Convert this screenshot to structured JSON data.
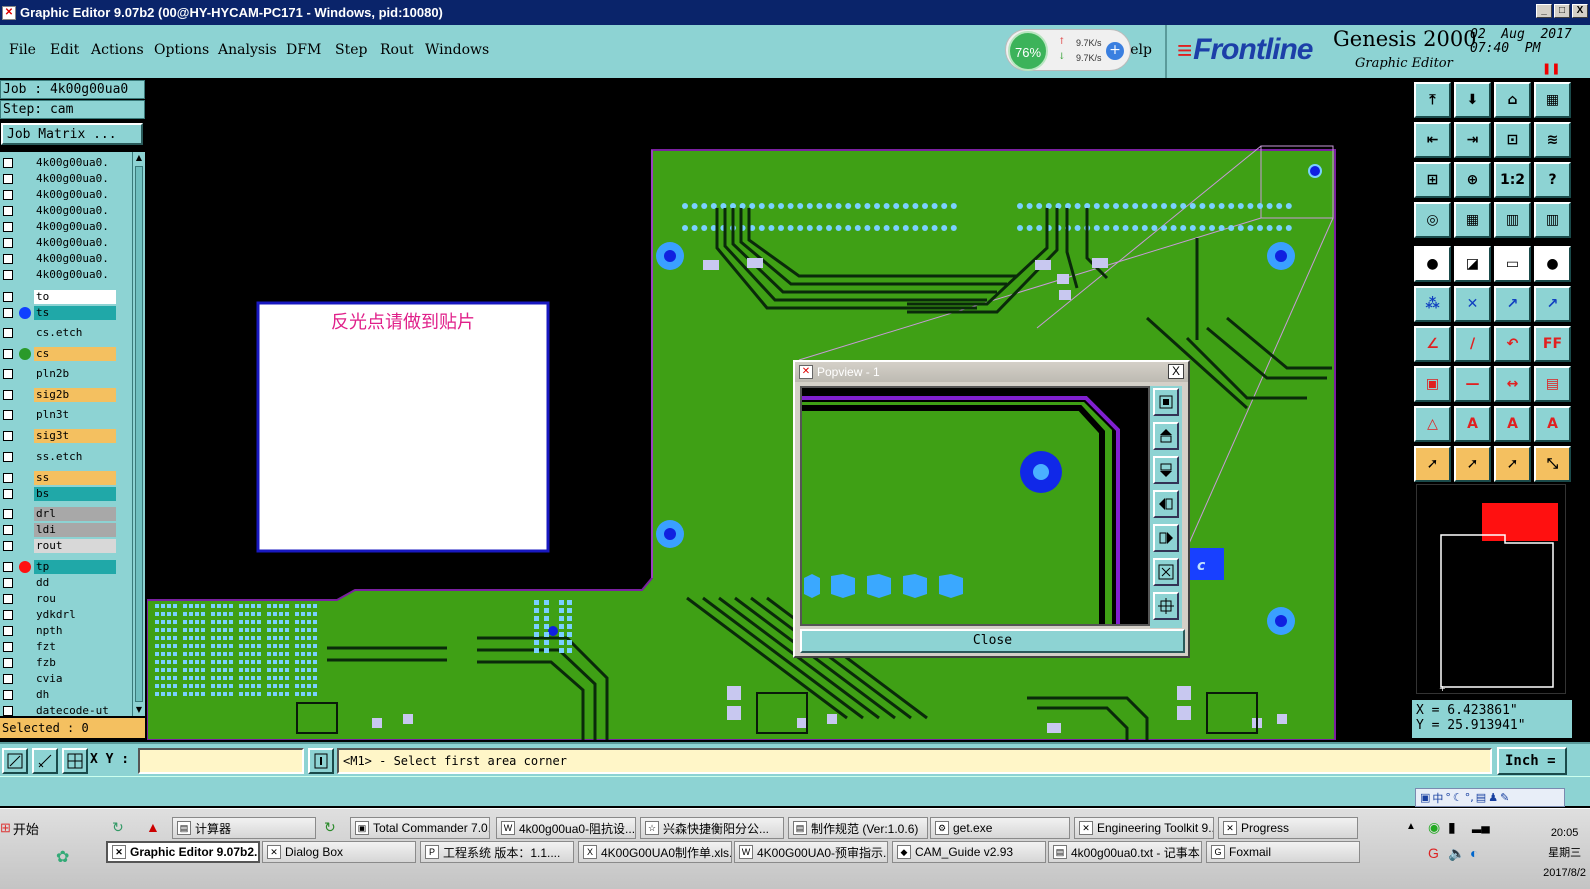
{
  "window": {
    "title": "Graphic Editor 9.07b2 (00@HY-HYCAM-PC171 - Windows, pid:10080)",
    "controls": [
      "_",
      "□",
      "X"
    ]
  },
  "menu": {
    "items": [
      "File",
      "Edit",
      "Actions",
      "Options",
      "Analysis",
      "DFM",
      "Step",
      "Rout",
      "Windows"
    ],
    "help": "Help"
  },
  "netmeter": {
    "percent": "76%",
    "up": "9.7K/s",
    "down": "9.7K/s",
    "plus": "+"
  },
  "brand": {
    "frontline": "Frontline",
    "genesis": "Genesis 2000",
    "graphic_editor": "Graphic Editor",
    "date": "02  Aug  2017\n07:40  PM"
  },
  "job": {
    "job_line": "Job : 4k00g00ua0",
    "step_line": "Step: cam",
    "matrix_button": "Job Matrix ..."
  },
  "layers": [
    {
      "name": "4k00g00ua0.",
      "color": "#8dd3d3",
      "dot": ""
    },
    {
      "name": "4k00g00ua0.",
      "color": "#8dd3d3",
      "dot": ""
    },
    {
      "name": "4k00g00ua0.",
      "color": "#8dd3d3",
      "dot": ""
    },
    {
      "name": "4k00g00ua0.",
      "color": "#8dd3d3",
      "dot": ""
    },
    {
      "name": "4k00g00ua0.",
      "color": "#8dd3d3",
      "dot": ""
    },
    {
      "name": "4k00g00ua0.",
      "color": "#8dd3d3",
      "dot": ""
    },
    {
      "name": "4k00g00ua0.",
      "color": "#8dd3d3",
      "dot": ""
    },
    {
      "name": "4k00g00ua0.",
      "color": "#8dd3d3",
      "dot": ""
    },
    {
      "name": "to",
      "color": "#ffffff",
      "dot": ""
    },
    {
      "name": "ts",
      "color": "#20a8a8",
      "dot": "#1040ff"
    },
    {
      "name": "cs.etch",
      "color": "#8dd3d3",
      "dot": ""
    },
    {
      "name": "cs",
      "color": "#f4c060",
      "dot": "#2a9a2a"
    },
    {
      "name": "pln2b",
      "color": "#8dd3d3",
      "dot": ""
    },
    {
      "name": "sig2b",
      "color": "#f4c060",
      "dot": ""
    },
    {
      "name": "pln3t",
      "color": "#8dd3d3",
      "dot": ""
    },
    {
      "name": "sig3t",
      "color": "#f4c060",
      "dot": ""
    },
    {
      "name": "ss.etch",
      "color": "#8dd3d3",
      "dot": ""
    },
    {
      "name": "ss",
      "color": "#f4c060",
      "dot": ""
    },
    {
      "name": "bs",
      "color": "#20a8a8",
      "dot": ""
    },
    {
      "name": "drl",
      "color": "#a8a8a8",
      "dot": ""
    },
    {
      "name": "ldi",
      "color": "#a8a8a8",
      "dot": ""
    },
    {
      "name": "rout",
      "color": "#d8d8d8",
      "dot": ""
    },
    {
      "name": "tp",
      "color": "#20a8a8",
      "dot": "#ff1010"
    },
    {
      "name": "dd",
      "color": "#8dd3d3",
      "dot": ""
    },
    {
      "name": "rou",
      "color": "#8dd3d3",
      "dot": ""
    },
    {
      "name": "ydkdrl",
      "color": "#8dd3d3",
      "dot": ""
    },
    {
      "name": "npth",
      "color": "#8dd3d3",
      "dot": ""
    },
    {
      "name": "fzt",
      "color": "#8dd3d3",
      "dot": ""
    },
    {
      "name": "fzb",
      "color": "#8dd3d3",
      "dot": ""
    },
    {
      "name": "cvia",
      "color": "#8dd3d3",
      "dot": ""
    },
    {
      "name": "dh",
      "color": "#8dd3d3",
      "dot": ""
    },
    {
      "name": "datecode-ut",
      "color": "#8dd3d3",
      "dot": ""
    }
  ],
  "selected": "Selected : 0",
  "annotation": {
    "text": "反光点请做到贴片"
  },
  "popview": {
    "title": "Popview - 1",
    "close_x": "X",
    "close_button": "Close"
  },
  "coords": {
    "x": "X = 6.423861\"",
    "y": "Y = 25.913941\""
  },
  "command": {
    "xy_label": "X Y :",
    "xy_value": "",
    "prompt": "<M1> - Select first area corner",
    "units": "Inch ="
  },
  "taskbar": {
    "start": "开始",
    "row1": [
      "计算器",
      "Total Commander 7.0...",
      "4k00g00ua0-阻抗设...",
      "兴森快捷衡阳分公...",
      "制作规范 (Ver:1.0.6)",
      "get.exe",
      "Engineering Toolkit 9....",
      "Progress"
    ],
    "row2": [
      "Graphic Editor 9.07b2...",
      "Dialog Box",
      "工程系统  版本：1.1....",
      "4K00G00UA0制作单.xls...",
      "4K00G00UA0-预审指示...",
      "CAM_Guide v2.93",
      "4k00g00ua0.txt - 记事本",
      "Foxmail"
    ],
    "clock_time": "20:05",
    "clock_day": "星期三",
    "clock_date": "2017/8/2"
  }
}
